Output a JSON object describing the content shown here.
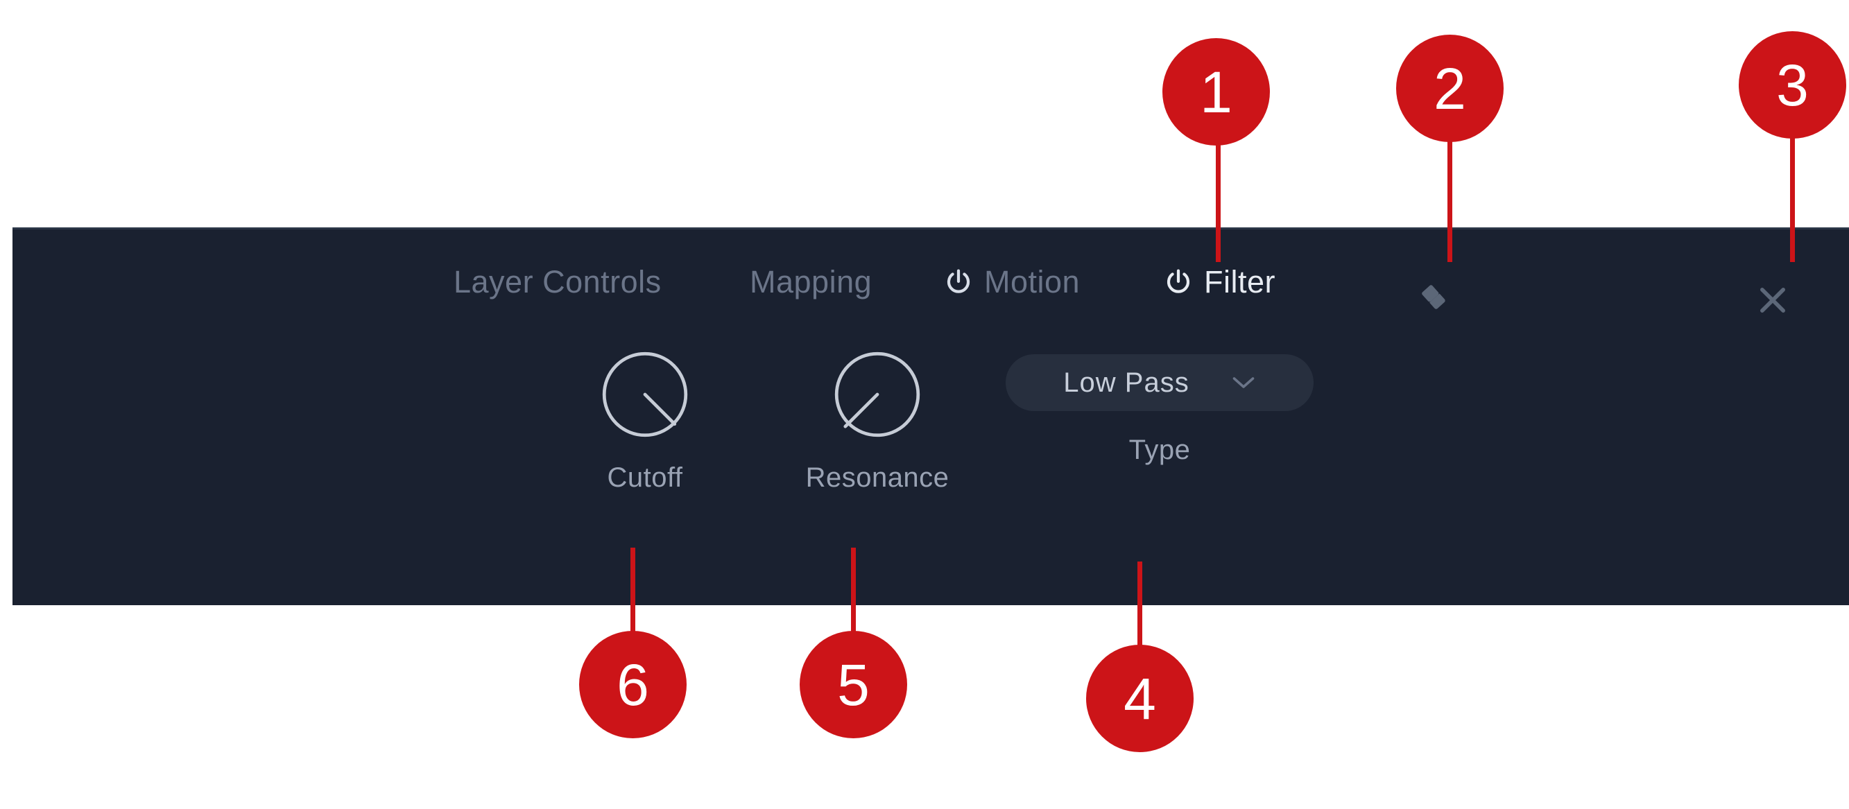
{
  "panel": {
    "background_color": "#1A2130",
    "accent_color": "#CC1418",
    "tabs": [
      {
        "id": "layer-controls",
        "label": "Layer Controls",
        "active": false,
        "has_power_icon": false,
        "icon": ""
      },
      {
        "id": "mapping",
        "label": "Mapping",
        "active": false,
        "has_power_icon": false,
        "icon": ""
      },
      {
        "id": "motion",
        "label": "Motion",
        "active": false,
        "has_power_icon": true,
        "icon": "power-icon"
      },
      {
        "id": "filter",
        "label": "Filter",
        "active": true,
        "has_power_icon": true,
        "icon": "power-icon"
      }
    ],
    "actions": [
      {
        "id": "eraser",
        "icon": "eraser-icon",
        "label": "Eraser"
      },
      {
        "id": "close",
        "icon": "close-icon",
        "label": "Close"
      }
    ],
    "controls": {
      "cutoff": {
        "label": "Cutoff",
        "icon": "knob-icon",
        "angle_deg": 133
      },
      "resonance": {
        "label": "Resonance",
        "icon": "knob-icon",
        "angle_deg": 232
      },
      "type": {
        "label": "Type",
        "value": "Low Pass",
        "icon": "chevron-down-icon"
      }
    }
  },
  "annotations": [
    {
      "number": "1",
      "target": "filter-tab"
    },
    {
      "number": "2",
      "target": "eraser-button"
    },
    {
      "number": "3",
      "target": "close-button"
    },
    {
      "number": "4",
      "target": "type-dropdown"
    },
    {
      "number": "5",
      "target": "resonance-knob"
    },
    {
      "number": "6",
      "target": "cutoff-knob"
    }
  ]
}
